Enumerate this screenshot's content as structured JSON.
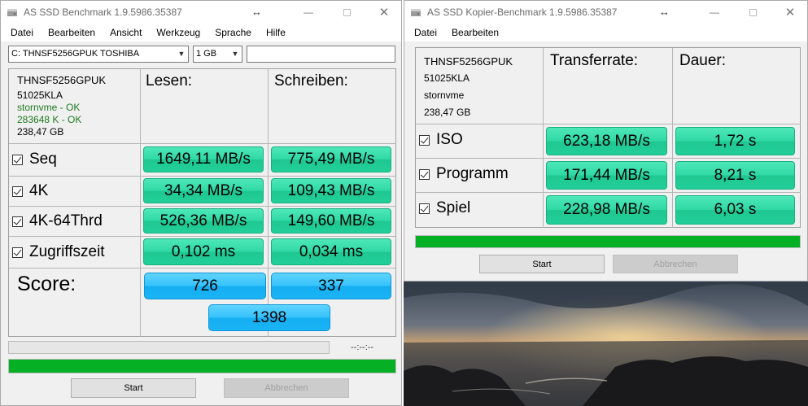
{
  "left_window": {
    "title": "AS SSD Benchmark 1.9.5986.35387",
    "menu": [
      "Datei",
      "Bearbeiten",
      "Ansicht",
      "Werkzeug",
      "Sprache",
      "Hilfe"
    ],
    "drive_select": "C: THNSF5256GPUK TOSHIBA",
    "size_select": "1 GB",
    "text_field": "",
    "device": {
      "model": "THNSF5256GPUK",
      "firmware": "51025KLA",
      "driver": "stornvme - OK",
      "alignment": "283648 K - OK",
      "capacity": "238,47 GB"
    },
    "col_read": "Lesen:",
    "col_write": "Schreiben:",
    "rows": [
      {
        "label": "Seq",
        "read": "1649,11 MB/s",
        "write": "775,49 MB/s"
      },
      {
        "label": "4K",
        "read": "34,34 MB/s",
        "write": "109,43 MB/s"
      },
      {
        "label": "4K-64Thrd",
        "read": "526,36 MB/s",
        "write": "149,60 MB/s"
      },
      {
        "label": "Zugriffszeit",
        "read": "0,102 ms",
        "write": "0,034 ms"
      }
    ],
    "score_label": "Score:",
    "score_read": "726",
    "score_write": "337",
    "score_total": "1398",
    "timer": "--:--:--",
    "progress_fraction": 1.0,
    "start_label": "Start",
    "cancel_label": "Abbrechen"
  },
  "right_window": {
    "title": "AS SSD Kopier-Benchmark 1.9.5986.35387",
    "menu": [
      "Datei",
      "Bearbeiten"
    ],
    "device": {
      "model": "THNSF5256GPUK",
      "firmware": "51025KLA",
      "driver": "stornvme",
      "capacity": "238,47 GB"
    },
    "col_rate": "Transferrate:",
    "col_time": "Dauer:",
    "rows": [
      {
        "label": "ISO",
        "rate": "623,18 MB/s",
        "time": "1,72 s"
      },
      {
        "label": "Programm",
        "rate": "171,44 MB/s",
        "time": "8,21 s"
      },
      {
        "label": "Spiel",
        "rate": "228,98 MB/s",
        "time": "6,03 s"
      }
    ],
    "progress_fraction": 1.0,
    "start_label": "Start",
    "cancel_label": "Abbrechen"
  },
  "colors": {
    "value_green": "#2fd9a4",
    "score_blue": "#1ab4f6",
    "progress_green": "#06b025"
  }
}
